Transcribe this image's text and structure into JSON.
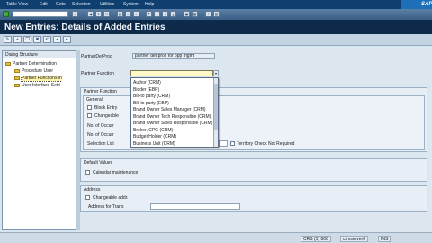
{
  "menubar": {
    "items": [
      "Table View",
      "Edit",
      "Goto",
      "Selection",
      "Utilities",
      "System",
      "Help"
    ],
    "logo": "SAP"
  },
  "title": "New Entries: Details of Added Entries",
  "dialog_structure": {
    "header": "Dialog Structure",
    "items": [
      {
        "label": "Partner Determination",
        "level": 0,
        "selected": false
      },
      {
        "label": "Procedure User",
        "level": 1,
        "selected": false
      },
      {
        "label": "Partner Functions in",
        "level": 1,
        "selected": true
      },
      {
        "label": "User Interface Setti",
        "level": 1,
        "selected": false
      }
    ]
  },
  "form": {
    "partner_det_proc_label": "PartnerDetProc",
    "partner_det_proc_value": "partner det proc for opp mgmt",
    "partner_function_label": "Partner Function",
    "partner_function_value": ""
  },
  "partner_function_group": {
    "title": "Partner Function",
    "general_title": "General",
    "block_entry_label": "Block Entry",
    "changeable_label": "Changeable",
    "occurrence1_label": "No. of Occurr",
    "occurrence2_label": "No. of Occurr",
    "selection_list_label": "Selection List",
    "territory_check_label": "Territory Check Not Required"
  },
  "dropdown": {
    "options": [
      "Author (CRM)",
      "Bidder (EBP)",
      "Bill-to party (CRM)",
      "Bill-to party (EBP)",
      "Brand Owner Sales Manager (CRM)",
      "Brand Owner Tech Responsible (CRM)",
      "Brand Owner Sales Responsible (CRM)",
      "Broker, CPG (CRM)",
      "Budget Holder (CRM)",
      "Business Unit (CRM)"
    ]
  },
  "default_values": {
    "title": "Default Values",
    "calendar_label": "Calendar maintenance"
  },
  "address": {
    "title": "Address",
    "changeable_label": "Changeable addr.",
    "address_for_trans_label": "Address for Trans"
  },
  "statusbar": {
    "system": "CRS (1) 800",
    "server": "crmserver6",
    "mode": "INS"
  }
}
